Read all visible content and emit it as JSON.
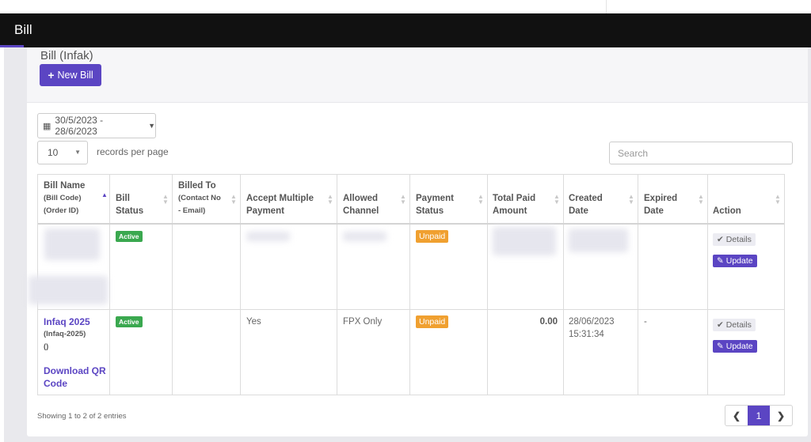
{
  "header": {
    "title": "Bill"
  },
  "panel": {
    "title": "Bill (Infak)",
    "new_button_label": "New Bill"
  },
  "filters": {
    "date_range": "30/5/2023 - 28/6/2023",
    "page_size": "10",
    "records_per_page_label": "records per page",
    "search_placeholder": "Search"
  },
  "table": {
    "headers": {
      "bill_name": "Bill Name",
      "bill_name_sub1": "(Bill Code)",
      "bill_name_sub2": "(Order ID)",
      "bill_status_1": "Bill",
      "bill_status_2": "Status",
      "billed_to": "Billed To",
      "billed_to_sub1": "(Contact No",
      "billed_to_sub2": "- Email)",
      "accept_1": "Accept Multiple",
      "accept_2": "Payment",
      "channel_1": "Allowed",
      "channel_2": "Channel",
      "pstatus_1": "Payment",
      "pstatus_2": "Status",
      "total_1": "Total Paid",
      "total_2": "Amount",
      "created_1": "Created",
      "created_2": "Date",
      "expired_1": "Expired",
      "expired_2": "Date",
      "action": "Action"
    },
    "rows": [
      {
        "status": "Active",
        "payment_status": "Unpaid",
        "details_label": "Details",
        "update_label": "Update"
      },
      {
        "bill_name": "Infaq 2025",
        "bill_code": "(Infaq-2025)",
        "order_id": "()",
        "download_label_1": "Download QR",
        "download_label_2": "Code",
        "status": "Active",
        "accept_multiple": "Yes",
        "channel": "FPX Only",
        "payment_status": "Unpaid",
        "total_paid": "0.00",
        "created_date": "28/06/2023",
        "created_time": "15:31:34",
        "expired_date": "-",
        "details_label": "Details",
        "update_label": "Update"
      }
    ]
  },
  "footer": {
    "info": "Showing 1 to 2 of 2 entries",
    "current_page": "1"
  },
  "colors": {
    "primary": "#5b45c3",
    "active_badge": "#3aa84f",
    "unpaid_badge": "#f0a030",
    "header_bg": "#111111"
  }
}
